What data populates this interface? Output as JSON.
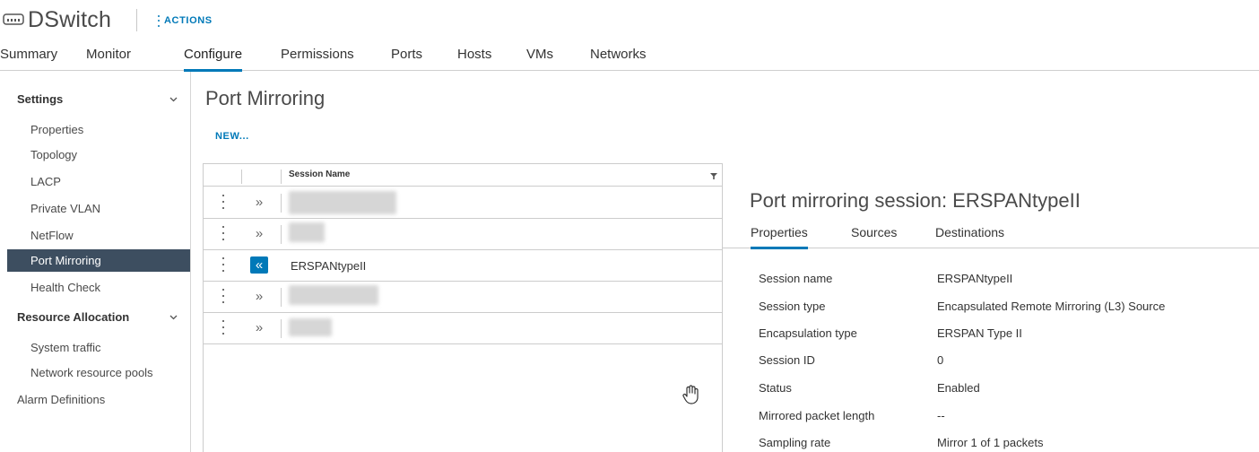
{
  "header": {
    "title": "DSwitch",
    "actions_label": "ACTIONS",
    "icon": "network-switch-icon"
  },
  "tabs": [
    {
      "label": "Summary"
    },
    {
      "label": "Monitor"
    },
    {
      "label": "Configure",
      "active": true
    },
    {
      "label": "Permissions"
    },
    {
      "label": "Ports"
    },
    {
      "label": "Hosts"
    },
    {
      "label": "VMs"
    },
    {
      "label": "Networks"
    }
  ],
  "sidebar": {
    "settings_label": "Settings",
    "settings_items": [
      {
        "label": "Properties"
      },
      {
        "label": "Topology"
      },
      {
        "label": "LACP"
      },
      {
        "label": "Private VLAN"
      },
      {
        "label": "NetFlow"
      },
      {
        "label": "Port Mirroring",
        "active": true
      },
      {
        "label": "Health Check"
      }
    ],
    "resource_label": "Resource Allocation",
    "resource_items": [
      {
        "label": "System traffic"
      },
      {
        "label": "Network resource pools"
      }
    ],
    "alarm_label": "Alarm Definitions"
  },
  "main": {
    "title": "Port Mirroring",
    "new_label": "NEW...",
    "grid": {
      "column_header": "Session Name",
      "rows": [
        {
          "name": "",
          "redacted": true,
          "selected": false
        },
        {
          "name": "",
          "redacted": true,
          "selected": false
        },
        {
          "name": "ERSPANtypeII",
          "redacted": false,
          "selected": true
        },
        {
          "name": "",
          "redacted": true,
          "selected": false
        },
        {
          "name": "",
          "redacted": true,
          "selected": false
        }
      ]
    }
  },
  "detail": {
    "title": "Port mirroring session: ERSPANtypeII",
    "tabs": [
      {
        "label": "Properties",
        "active": true
      },
      {
        "label": "Sources"
      },
      {
        "label": "Destinations"
      }
    ],
    "properties": [
      {
        "label": "Session name",
        "value": "ERSPANtypeII"
      },
      {
        "label": "Session type",
        "value": "Encapsulated Remote Mirroring (L3) Source"
      },
      {
        "label": "Encapsulation type",
        "value": "ERSPAN Type II"
      },
      {
        "label": "Session ID",
        "value": "0"
      },
      {
        "label": "Status",
        "value": "Enabled"
      },
      {
        "label": "Mirrored packet length",
        "value": "--"
      },
      {
        "label": "Sampling rate",
        "value": "Mirror 1 of 1 packets"
      }
    ]
  },
  "colors": {
    "accent": "#0079b8",
    "nav_active_bg": "#3d4e60"
  }
}
